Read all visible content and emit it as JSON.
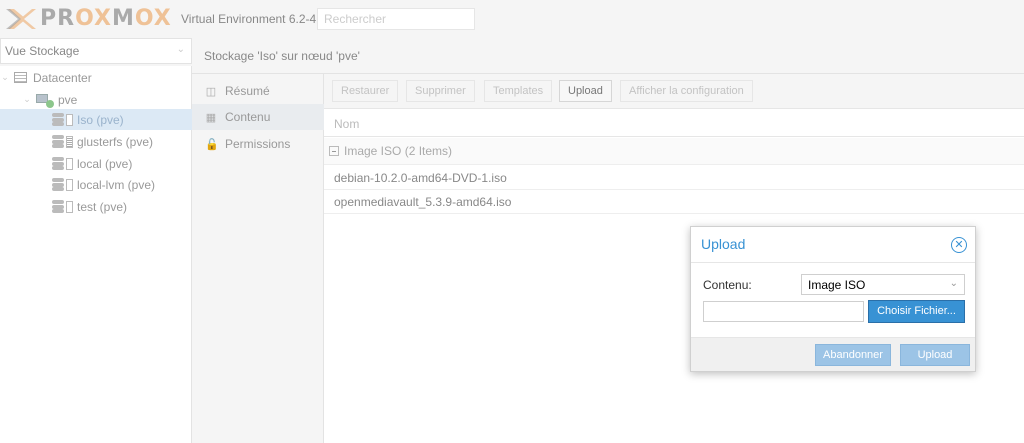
{
  "header": {
    "logo": {
      "letters": "PROXMOX",
      "prefix": "PR",
      "ox1": "OX",
      "mid": "M",
      "ox2": "OX"
    },
    "version": "Virtual Environment 6.2-4",
    "search_placeholder": "Rechercher"
  },
  "sidebar": {
    "view_selector": "Vue Stockage",
    "tree": [
      {
        "label": "Datacenter",
        "icon": "datacenter-icon"
      },
      {
        "label": "pve",
        "icon": "node-online-icon"
      },
      {
        "label": "Iso (pve)",
        "icon": "storage-icon",
        "selected": true
      },
      {
        "label": "glusterfs (pve)",
        "icon": "storage-icon"
      },
      {
        "label": "local (pve)",
        "icon": "storage-icon"
      },
      {
        "label": "local-lvm (pve)",
        "icon": "storage-icon"
      },
      {
        "label": "test (pve)",
        "icon": "storage-icon"
      }
    ]
  },
  "content": {
    "title": "Stockage 'Iso' sur nœud 'pve'",
    "subnav": [
      {
        "label": "Résumé",
        "icon": "book-icon"
      },
      {
        "label": "Contenu",
        "icon": "grid-icon",
        "active": true
      },
      {
        "label": "Permissions",
        "icon": "unlock-icon"
      }
    ],
    "toolbar": {
      "restore": "Restaurer",
      "delete": "Supprimer",
      "templates": "Templates",
      "upload": "Upload",
      "show_config": "Afficher la configuration"
    },
    "grid": {
      "column": "Nom",
      "group": "Image ISO (2 Items)",
      "rows": [
        "debian-10.2.0-amd64-DVD-1.iso",
        "openmediavault_5.3.9-amd64.iso"
      ]
    }
  },
  "dialog": {
    "title": "Upload",
    "content_label": "Contenu:",
    "content_value": "Image ISO",
    "file_value": "",
    "browse": "Choisir Fichier...",
    "cancel": "Abandonner",
    "upload": "Upload"
  },
  "colors": {
    "accent": "#3892d4",
    "brand": "#e57000"
  }
}
